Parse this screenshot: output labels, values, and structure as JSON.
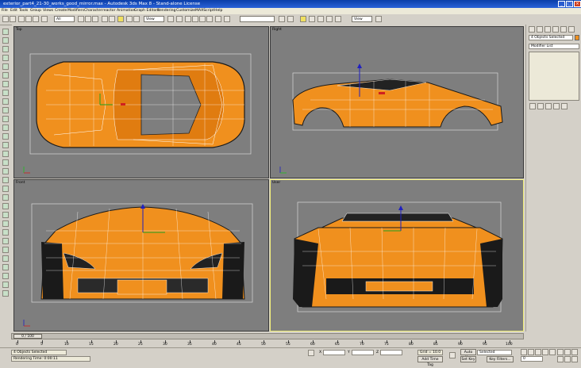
{
  "window": {
    "title": "exterior_part4_21-30_works_good_mirror.max - Autodesk 3ds Max 8  - Stand-alone License",
    "min": "_",
    "max": "□",
    "close": "×"
  },
  "menu": [
    "File",
    "Edit",
    "Tools",
    "Group",
    "Views",
    "Create",
    "Modifiers",
    "Character",
    "reactor",
    "Animation",
    "Graph Editors",
    "Rendering",
    "Customize",
    "MAXScript",
    "Help"
  ],
  "toolbar": {
    "selection_filter": "All",
    "ref_coord_1": "View",
    "ref_coord_2": "View",
    "named_selection": ""
  },
  "viewports": [
    {
      "label": "Top"
    },
    {
      "label": "Right"
    },
    {
      "label": "Front"
    },
    {
      "label": "User"
    }
  ],
  "command_panel": {
    "selection_info": "4 Objects Selected",
    "modifier_list": "Modifier List"
  },
  "timeline": {
    "slider_label": "0 / 100",
    "ticks": [
      "0",
      "5",
      "10",
      "15",
      "20",
      "25",
      "30",
      "35",
      "40",
      "45",
      "50",
      "55",
      "60",
      "65",
      "70",
      "75",
      "80",
      "85",
      "90",
      "95",
      "100"
    ]
  },
  "status": {
    "selection": "4 Objects Selected",
    "prompt": "Rendering Time: 0:00:11",
    "grid_label": "Grid = 10.0",
    "add_time_tag": "Add Time Tag",
    "auto_key": "Auto Key",
    "set_key": "Set Key",
    "selected_dropdown": "Selected",
    "key_filters": "Key Filters...",
    "frame": "0",
    "x_label": "X",
    "y_label": "Y",
    "z_label": "Z"
  },
  "colors": {
    "mesh": "#f0901e",
    "wire": "#ffffff",
    "viewport_bg": "#7e7e7e",
    "active_border": "#f0ee7a"
  }
}
